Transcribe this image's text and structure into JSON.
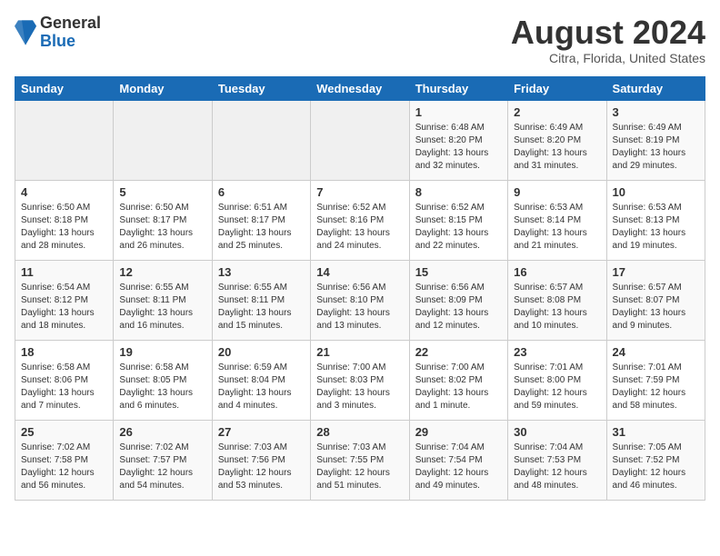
{
  "header": {
    "logo_general": "General",
    "logo_blue": "Blue",
    "title": "August 2024",
    "subtitle": "Citra, Florida, United States"
  },
  "weekdays": [
    "Sunday",
    "Monday",
    "Tuesday",
    "Wednesday",
    "Thursday",
    "Friday",
    "Saturday"
  ],
  "weeks": [
    [
      {
        "day": "",
        "info": ""
      },
      {
        "day": "",
        "info": ""
      },
      {
        "day": "",
        "info": ""
      },
      {
        "day": "",
        "info": ""
      },
      {
        "day": "1",
        "info": "Sunrise: 6:48 AM\nSunset: 8:20 PM\nDaylight: 13 hours\nand 32 minutes."
      },
      {
        "day": "2",
        "info": "Sunrise: 6:49 AM\nSunset: 8:20 PM\nDaylight: 13 hours\nand 31 minutes."
      },
      {
        "day": "3",
        "info": "Sunrise: 6:49 AM\nSunset: 8:19 PM\nDaylight: 13 hours\nand 29 minutes."
      }
    ],
    [
      {
        "day": "4",
        "info": "Sunrise: 6:50 AM\nSunset: 8:18 PM\nDaylight: 13 hours\nand 28 minutes."
      },
      {
        "day": "5",
        "info": "Sunrise: 6:50 AM\nSunset: 8:17 PM\nDaylight: 13 hours\nand 26 minutes."
      },
      {
        "day": "6",
        "info": "Sunrise: 6:51 AM\nSunset: 8:17 PM\nDaylight: 13 hours\nand 25 minutes."
      },
      {
        "day": "7",
        "info": "Sunrise: 6:52 AM\nSunset: 8:16 PM\nDaylight: 13 hours\nand 24 minutes."
      },
      {
        "day": "8",
        "info": "Sunrise: 6:52 AM\nSunset: 8:15 PM\nDaylight: 13 hours\nand 22 minutes."
      },
      {
        "day": "9",
        "info": "Sunrise: 6:53 AM\nSunset: 8:14 PM\nDaylight: 13 hours\nand 21 minutes."
      },
      {
        "day": "10",
        "info": "Sunrise: 6:53 AM\nSunset: 8:13 PM\nDaylight: 13 hours\nand 19 minutes."
      }
    ],
    [
      {
        "day": "11",
        "info": "Sunrise: 6:54 AM\nSunset: 8:12 PM\nDaylight: 13 hours\nand 18 minutes."
      },
      {
        "day": "12",
        "info": "Sunrise: 6:55 AM\nSunset: 8:11 PM\nDaylight: 13 hours\nand 16 minutes."
      },
      {
        "day": "13",
        "info": "Sunrise: 6:55 AM\nSunset: 8:11 PM\nDaylight: 13 hours\nand 15 minutes."
      },
      {
        "day": "14",
        "info": "Sunrise: 6:56 AM\nSunset: 8:10 PM\nDaylight: 13 hours\nand 13 minutes."
      },
      {
        "day": "15",
        "info": "Sunrise: 6:56 AM\nSunset: 8:09 PM\nDaylight: 13 hours\nand 12 minutes."
      },
      {
        "day": "16",
        "info": "Sunrise: 6:57 AM\nSunset: 8:08 PM\nDaylight: 13 hours\nand 10 minutes."
      },
      {
        "day": "17",
        "info": "Sunrise: 6:57 AM\nSunset: 8:07 PM\nDaylight: 13 hours\nand 9 minutes."
      }
    ],
    [
      {
        "day": "18",
        "info": "Sunrise: 6:58 AM\nSunset: 8:06 PM\nDaylight: 13 hours\nand 7 minutes."
      },
      {
        "day": "19",
        "info": "Sunrise: 6:58 AM\nSunset: 8:05 PM\nDaylight: 13 hours\nand 6 minutes."
      },
      {
        "day": "20",
        "info": "Sunrise: 6:59 AM\nSunset: 8:04 PM\nDaylight: 13 hours\nand 4 minutes."
      },
      {
        "day": "21",
        "info": "Sunrise: 7:00 AM\nSunset: 8:03 PM\nDaylight: 13 hours\nand 3 minutes."
      },
      {
        "day": "22",
        "info": "Sunrise: 7:00 AM\nSunset: 8:02 PM\nDaylight: 13 hours\nand 1 minute."
      },
      {
        "day": "23",
        "info": "Sunrise: 7:01 AM\nSunset: 8:00 PM\nDaylight: 12 hours\nand 59 minutes."
      },
      {
        "day": "24",
        "info": "Sunrise: 7:01 AM\nSunset: 7:59 PM\nDaylight: 12 hours\nand 58 minutes."
      }
    ],
    [
      {
        "day": "25",
        "info": "Sunrise: 7:02 AM\nSunset: 7:58 PM\nDaylight: 12 hours\nand 56 minutes."
      },
      {
        "day": "26",
        "info": "Sunrise: 7:02 AM\nSunset: 7:57 PM\nDaylight: 12 hours\nand 54 minutes."
      },
      {
        "day": "27",
        "info": "Sunrise: 7:03 AM\nSunset: 7:56 PM\nDaylight: 12 hours\nand 53 minutes."
      },
      {
        "day": "28",
        "info": "Sunrise: 7:03 AM\nSunset: 7:55 PM\nDaylight: 12 hours\nand 51 minutes."
      },
      {
        "day": "29",
        "info": "Sunrise: 7:04 AM\nSunset: 7:54 PM\nDaylight: 12 hours\nand 49 minutes."
      },
      {
        "day": "30",
        "info": "Sunrise: 7:04 AM\nSunset: 7:53 PM\nDaylight: 12 hours\nand 48 minutes."
      },
      {
        "day": "31",
        "info": "Sunrise: 7:05 AM\nSunset: 7:52 PM\nDaylight: 12 hours\nand 46 minutes."
      }
    ]
  ]
}
